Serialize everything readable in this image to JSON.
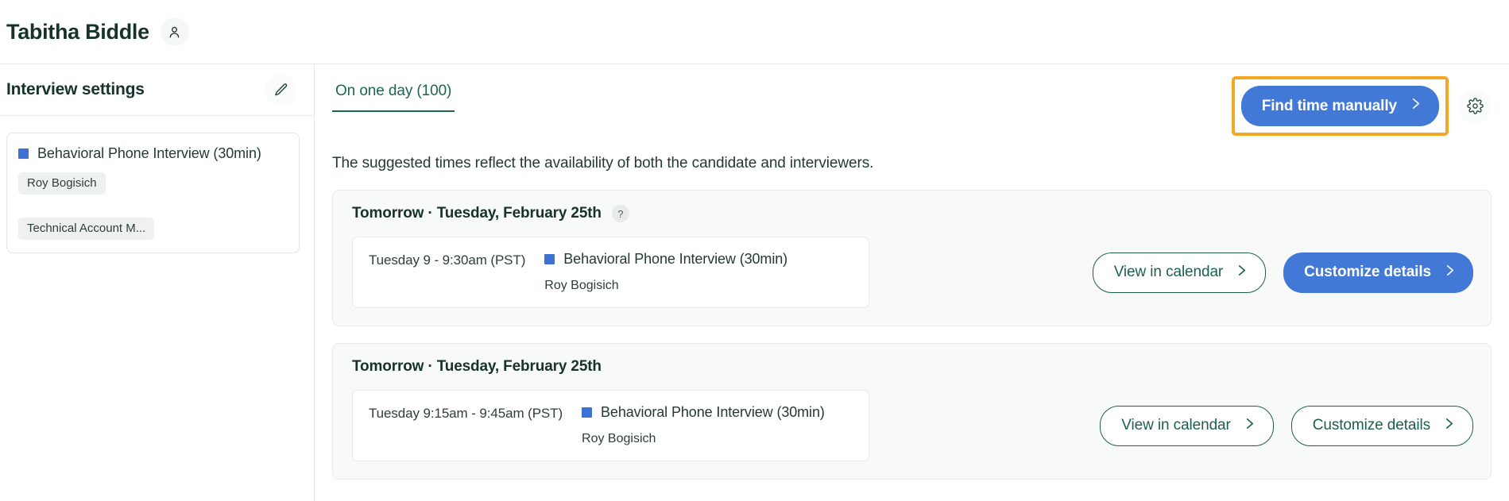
{
  "topbar": {
    "candidate_name": "Tabitha Biddle",
    "person_icon": "person-icon"
  },
  "sidebar": {
    "title": "Interview settings",
    "edit_icon": "pencil-icon",
    "interview": {
      "name": "Behavioral Phone Interview (30min)",
      "swatch_color": "#3b72d4",
      "tags": [
        "Roy Bogisich",
        "Technical Account M..."
      ]
    }
  },
  "main": {
    "tabs": [
      {
        "label": "On one day (100)",
        "active": true
      }
    ],
    "find_time_button": {
      "label": "Find time manually",
      "chevron": "chevron-right-icon",
      "color": "#4279d6",
      "highlight_color": "#f5a623"
    },
    "settings_icon": "gear-icon",
    "subtitle": "The suggested times reflect the availability of both the candidate and interviewers.",
    "cards": [
      {
        "date": "Tomorrow · Tuesday, February 25th",
        "help_badge": "?",
        "has_help_badge": true,
        "slot_time": "Tuesday 9 - 9:30am (PST)",
        "slot_title": "Behavioral Phone Interview (30min)",
        "slot_swatch": "#3b72d4",
        "slot_person": "Roy Bogisich",
        "view_label": "View in calendar",
        "customize_label": "Customize details",
        "customize_primary": true
      },
      {
        "date": "Tomorrow · Tuesday, February 25th",
        "help_badge": "",
        "has_help_badge": false,
        "slot_time": "Tuesday 9:15am - 9:45am (PST)",
        "slot_title": "Behavioral Phone Interview (30min)",
        "slot_swatch": "#3b72d4",
        "slot_person": "Roy Bogisich",
        "view_label": "View in calendar",
        "customize_label": "Customize details",
        "customize_primary": false
      }
    ]
  }
}
